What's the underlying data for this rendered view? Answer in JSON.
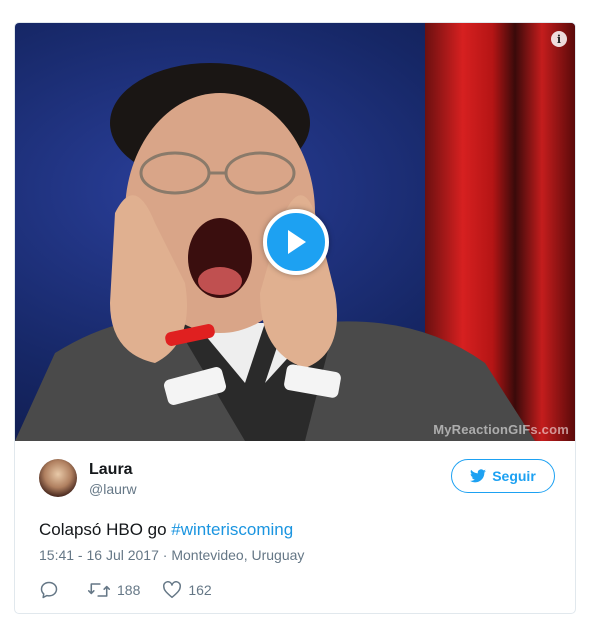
{
  "media": {
    "watermark": "MyReactionGIFs.com",
    "info_icon": "info-icon",
    "play_icon": "play-icon"
  },
  "author": {
    "name": "Laura",
    "handle": "@laurw"
  },
  "follow": {
    "label": "Seguir",
    "icon": "twitter-bird-icon"
  },
  "tweet": {
    "text": "Colapsó HBO go ",
    "hashtag": "#winteriscoming",
    "timestamp": "15:41 - 16 Jul 2017",
    "separator": " · ",
    "location": "Montevideo, Uruguay"
  },
  "actions": {
    "reply_count": "",
    "retweet_count": "188",
    "like_count": "162"
  },
  "colors": {
    "accent": "#1da1f2",
    "hashtag": "#1b95e0",
    "muted": "#657786",
    "border": "#e1e8ed"
  }
}
